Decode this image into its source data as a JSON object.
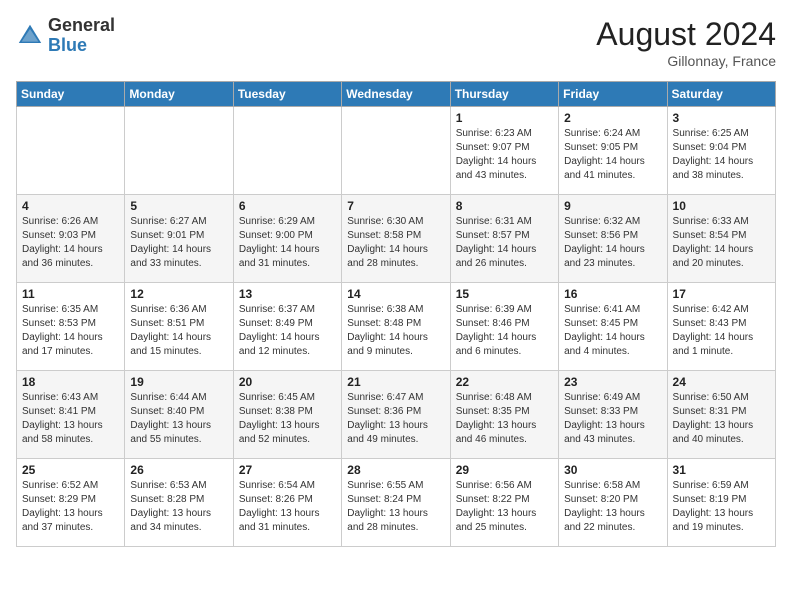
{
  "logo": {
    "general": "General",
    "blue": "Blue"
  },
  "title": {
    "month_year": "August 2024",
    "location": "Gillonnay, France"
  },
  "days_of_week": [
    "Sunday",
    "Monday",
    "Tuesday",
    "Wednesday",
    "Thursday",
    "Friday",
    "Saturday"
  ],
  "weeks": [
    [
      {
        "day": "",
        "info": ""
      },
      {
        "day": "",
        "info": ""
      },
      {
        "day": "",
        "info": ""
      },
      {
        "day": "",
        "info": ""
      },
      {
        "day": "1",
        "info": "Sunrise: 6:23 AM\nSunset: 9:07 PM\nDaylight: 14 hours and 43 minutes."
      },
      {
        "day": "2",
        "info": "Sunrise: 6:24 AM\nSunset: 9:05 PM\nDaylight: 14 hours and 41 minutes."
      },
      {
        "day": "3",
        "info": "Sunrise: 6:25 AM\nSunset: 9:04 PM\nDaylight: 14 hours and 38 minutes."
      }
    ],
    [
      {
        "day": "4",
        "info": "Sunrise: 6:26 AM\nSunset: 9:03 PM\nDaylight: 14 hours and 36 minutes."
      },
      {
        "day": "5",
        "info": "Sunrise: 6:27 AM\nSunset: 9:01 PM\nDaylight: 14 hours and 33 minutes."
      },
      {
        "day": "6",
        "info": "Sunrise: 6:29 AM\nSunset: 9:00 PM\nDaylight: 14 hours and 31 minutes."
      },
      {
        "day": "7",
        "info": "Sunrise: 6:30 AM\nSunset: 8:58 PM\nDaylight: 14 hours and 28 minutes."
      },
      {
        "day": "8",
        "info": "Sunrise: 6:31 AM\nSunset: 8:57 PM\nDaylight: 14 hours and 26 minutes."
      },
      {
        "day": "9",
        "info": "Sunrise: 6:32 AM\nSunset: 8:56 PM\nDaylight: 14 hours and 23 minutes."
      },
      {
        "day": "10",
        "info": "Sunrise: 6:33 AM\nSunset: 8:54 PM\nDaylight: 14 hours and 20 minutes."
      }
    ],
    [
      {
        "day": "11",
        "info": "Sunrise: 6:35 AM\nSunset: 8:53 PM\nDaylight: 14 hours and 17 minutes."
      },
      {
        "day": "12",
        "info": "Sunrise: 6:36 AM\nSunset: 8:51 PM\nDaylight: 14 hours and 15 minutes."
      },
      {
        "day": "13",
        "info": "Sunrise: 6:37 AM\nSunset: 8:49 PM\nDaylight: 14 hours and 12 minutes."
      },
      {
        "day": "14",
        "info": "Sunrise: 6:38 AM\nSunset: 8:48 PM\nDaylight: 14 hours and 9 minutes."
      },
      {
        "day": "15",
        "info": "Sunrise: 6:39 AM\nSunset: 8:46 PM\nDaylight: 14 hours and 6 minutes."
      },
      {
        "day": "16",
        "info": "Sunrise: 6:41 AM\nSunset: 8:45 PM\nDaylight: 14 hours and 4 minutes."
      },
      {
        "day": "17",
        "info": "Sunrise: 6:42 AM\nSunset: 8:43 PM\nDaylight: 14 hours and 1 minute."
      }
    ],
    [
      {
        "day": "18",
        "info": "Sunrise: 6:43 AM\nSunset: 8:41 PM\nDaylight: 13 hours and 58 minutes."
      },
      {
        "day": "19",
        "info": "Sunrise: 6:44 AM\nSunset: 8:40 PM\nDaylight: 13 hours and 55 minutes."
      },
      {
        "day": "20",
        "info": "Sunrise: 6:45 AM\nSunset: 8:38 PM\nDaylight: 13 hours and 52 minutes."
      },
      {
        "day": "21",
        "info": "Sunrise: 6:47 AM\nSunset: 8:36 PM\nDaylight: 13 hours and 49 minutes."
      },
      {
        "day": "22",
        "info": "Sunrise: 6:48 AM\nSunset: 8:35 PM\nDaylight: 13 hours and 46 minutes."
      },
      {
        "day": "23",
        "info": "Sunrise: 6:49 AM\nSunset: 8:33 PM\nDaylight: 13 hours and 43 minutes."
      },
      {
        "day": "24",
        "info": "Sunrise: 6:50 AM\nSunset: 8:31 PM\nDaylight: 13 hours and 40 minutes."
      }
    ],
    [
      {
        "day": "25",
        "info": "Sunrise: 6:52 AM\nSunset: 8:29 PM\nDaylight: 13 hours and 37 minutes."
      },
      {
        "day": "26",
        "info": "Sunrise: 6:53 AM\nSunset: 8:28 PM\nDaylight: 13 hours and 34 minutes."
      },
      {
        "day": "27",
        "info": "Sunrise: 6:54 AM\nSunset: 8:26 PM\nDaylight: 13 hours and 31 minutes."
      },
      {
        "day": "28",
        "info": "Sunrise: 6:55 AM\nSunset: 8:24 PM\nDaylight: 13 hours and 28 minutes."
      },
      {
        "day": "29",
        "info": "Sunrise: 6:56 AM\nSunset: 8:22 PM\nDaylight: 13 hours and 25 minutes."
      },
      {
        "day": "30",
        "info": "Sunrise: 6:58 AM\nSunset: 8:20 PM\nDaylight: 13 hours and 22 minutes."
      },
      {
        "day": "31",
        "info": "Sunrise: 6:59 AM\nSunset: 8:19 PM\nDaylight: 13 hours and 19 minutes."
      }
    ]
  ]
}
